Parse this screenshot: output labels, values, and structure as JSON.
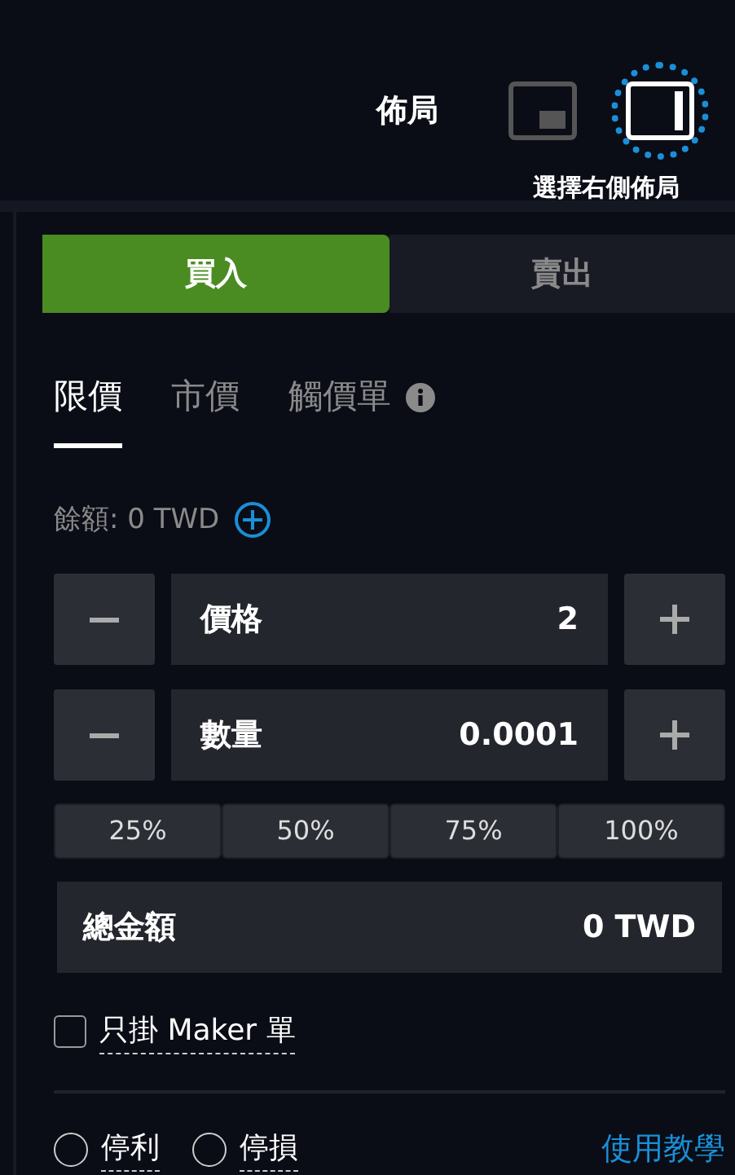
{
  "layout": {
    "label": "佈局",
    "options": [
      {
        "kind": "overlay",
        "selected": false
      },
      {
        "kind": "right",
        "selected": true
      }
    ],
    "caption": "選擇右側佈局"
  },
  "side_tabs": [
    {
      "label": "買入",
      "selected": true
    },
    {
      "label": "賣出",
      "selected": false
    }
  ],
  "order_tabs": [
    {
      "label": "限價",
      "selected": true,
      "info": false
    },
    {
      "label": "市價",
      "selected": false,
      "info": false
    },
    {
      "label": "觸價單",
      "selected": false,
      "info": true
    }
  ],
  "balance": {
    "text": "餘額: 0 TWD"
  },
  "inputs": [
    {
      "label": "價格",
      "value": "2"
    },
    {
      "label": "數量",
      "value": "0.0001"
    }
  ],
  "percent_buttons": [
    "25%",
    "50%",
    "75%",
    "100%"
  ],
  "total": {
    "label": "總金額",
    "value": "0 TWD"
  },
  "maker_only": {
    "label": "只掛 Maker 單",
    "checked": false
  },
  "stop_options": [
    {
      "label": "停利",
      "selected": false
    },
    {
      "label": "停損",
      "selected": false
    }
  ],
  "tutorial_link": "使用教學"
}
